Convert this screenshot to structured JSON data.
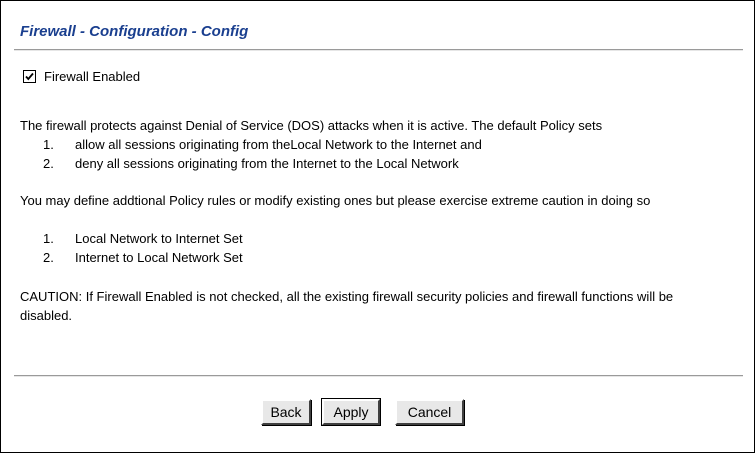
{
  "page": {
    "title": "Firewall - Configuration - Config"
  },
  "firewall": {
    "checkbox_label": "Firewall Enabled",
    "checked": true
  },
  "description": {
    "intro": "The firewall protects against Denial of Service (DOS) attacks when it is active. The default Policy sets",
    "default_items": [
      {
        "num": "1.",
        "text": "allow all sessions originating from theLocal Network to the Internet and"
      },
      {
        "num": "2.",
        "text": "deny all sessions originating from the Internet to the Local Network"
      }
    ],
    "policy_intro": "You may define addtional Policy rules or modify existing ones but please exercise extreme caution in doing so",
    "policy_items": [
      {
        "num": "1.",
        "text": "Local Network to Internet Set"
      },
      {
        "num": "2.",
        "text": "Internet to Local Network Set"
      }
    ],
    "caution": "CAUTION: If Firewall Enabled is not checked, all the existing firewall security policies and firewall functions will be disabled."
  },
  "buttons": {
    "back": "Back",
    "apply": "Apply",
    "cancel": "Cancel"
  }
}
